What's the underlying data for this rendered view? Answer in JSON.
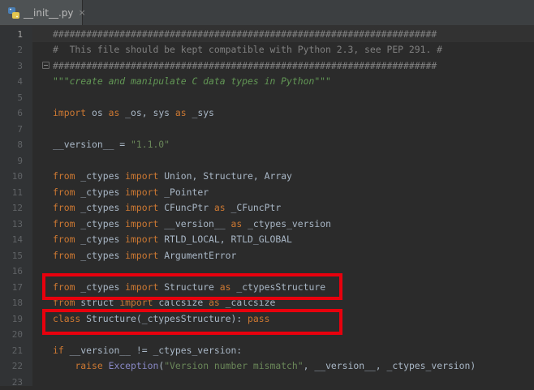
{
  "tab": {
    "filename": "__init__.py",
    "close": "×"
  },
  "lines": [
    {
      "n": "1",
      "parts": [
        {
          "c": "cm",
          "t": "#####################################################################"
        }
      ]
    },
    {
      "n": "2",
      "parts": [
        {
          "c": "cm",
          "t": "#  This file should be kept compatible with Python 2.3, see PEP 291. #"
        }
      ]
    },
    {
      "n": "3",
      "parts": [
        {
          "c": "cm",
          "t": "#####################################################################"
        }
      ]
    },
    {
      "n": "4",
      "parts": [
        {
          "c": "doc",
          "t": "\"\"\"create and manipulate C data types in Python\"\"\""
        }
      ]
    },
    {
      "n": "5",
      "parts": []
    },
    {
      "n": "6",
      "parts": [
        {
          "c": "kw",
          "t": "import "
        },
        {
          "c": "fn",
          "t": "os "
        },
        {
          "c": "kw",
          "t": "as "
        },
        {
          "c": "fn",
          "t": "_os, sys "
        },
        {
          "c": "kw",
          "t": "as "
        },
        {
          "c": "fn",
          "t": "_sys"
        }
      ]
    },
    {
      "n": "7",
      "parts": []
    },
    {
      "n": "8",
      "parts": [
        {
          "c": "fn",
          "t": "__version__ = "
        },
        {
          "c": "str",
          "t": "\"1.1.0\""
        }
      ]
    },
    {
      "n": "9",
      "parts": []
    },
    {
      "n": "10",
      "parts": [
        {
          "c": "kw",
          "t": "from "
        },
        {
          "c": "fn",
          "t": "_ctypes "
        },
        {
          "c": "kw",
          "t": "import "
        },
        {
          "c": "fn",
          "t": "Union, Structure, Array"
        }
      ]
    },
    {
      "n": "11",
      "parts": [
        {
          "c": "kw",
          "t": "from "
        },
        {
          "c": "fn",
          "t": "_ctypes "
        },
        {
          "c": "kw",
          "t": "import "
        },
        {
          "c": "fn",
          "t": "_Pointer"
        }
      ]
    },
    {
      "n": "12",
      "parts": [
        {
          "c": "kw",
          "t": "from "
        },
        {
          "c": "fn",
          "t": "_ctypes "
        },
        {
          "c": "kw",
          "t": "import "
        },
        {
          "c": "fn",
          "t": "CFuncPtr "
        },
        {
          "c": "kw",
          "t": "as "
        },
        {
          "c": "fn",
          "t": "_CFuncPtr"
        }
      ]
    },
    {
      "n": "13",
      "parts": [
        {
          "c": "kw",
          "t": "from "
        },
        {
          "c": "fn",
          "t": "_ctypes "
        },
        {
          "c": "kw",
          "t": "import "
        },
        {
          "c": "fn",
          "t": "__version__ "
        },
        {
          "c": "kw",
          "t": "as "
        },
        {
          "c": "fn",
          "t": "_ctypes_version"
        }
      ]
    },
    {
      "n": "14",
      "parts": [
        {
          "c": "kw",
          "t": "from "
        },
        {
          "c": "fn",
          "t": "_ctypes "
        },
        {
          "c": "kw",
          "t": "import "
        },
        {
          "c": "fn",
          "t": "RTLD_LOCAL, RTLD_GLOBAL"
        }
      ]
    },
    {
      "n": "15",
      "parts": [
        {
          "c": "kw",
          "t": "from "
        },
        {
          "c": "fn",
          "t": "_ctypes "
        },
        {
          "c": "kw",
          "t": "import "
        },
        {
          "c": "fn",
          "t": "ArgumentError"
        }
      ]
    },
    {
      "n": "16",
      "parts": []
    },
    {
      "n": "17",
      "parts": [
        {
          "c": "kw",
          "t": "from "
        },
        {
          "c": "fn",
          "t": "_ctypes "
        },
        {
          "c": "kw",
          "t": "import "
        },
        {
          "c": "fn",
          "t": "Structure "
        },
        {
          "c": "kw",
          "t": "as "
        },
        {
          "c": "fn",
          "t": "_ctypesStructure"
        }
      ]
    },
    {
      "n": "18",
      "parts": [
        {
          "c": "kw",
          "t": "from "
        },
        {
          "c": "fn",
          "t": "struct "
        },
        {
          "c": "kw",
          "t": "import "
        },
        {
          "c": "fn",
          "t": "calcsize "
        },
        {
          "c": "kw",
          "t": "as "
        },
        {
          "c": "fn",
          "t": "_calcsize"
        }
      ]
    },
    {
      "n": "19",
      "parts": [
        {
          "c": "kw",
          "t": "class "
        },
        {
          "c": "fn",
          "t": "Structure(_ctypesStructure): "
        },
        {
          "c": "kw",
          "t": "pass"
        }
      ]
    },
    {
      "n": "20",
      "parts": []
    },
    {
      "n": "21",
      "parts": [
        {
          "c": "kw",
          "t": "if "
        },
        {
          "c": "fn",
          "t": "__version__ != _ctypes_version:"
        }
      ]
    },
    {
      "n": "22",
      "parts": [
        {
          "c": "fn",
          "t": "    "
        },
        {
          "c": "kw",
          "t": "raise "
        },
        {
          "c": "builtin",
          "t": "Exception"
        },
        {
          "c": "fn",
          "t": "("
        },
        {
          "c": "str",
          "t": "\"Version number mismatch\""
        },
        {
          "c": "fn",
          "t": ", __version__, _ctypes_version)"
        }
      ]
    },
    {
      "n": "23",
      "parts": []
    }
  ],
  "colors": {
    "highlight_box": "#e8000d",
    "background": "#2b2b2b"
  }
}
